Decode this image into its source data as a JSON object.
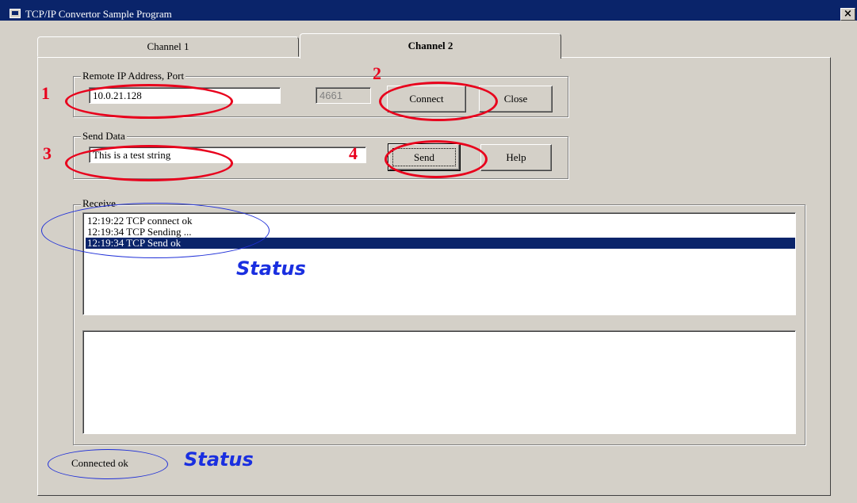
{
  "window": {
    "title": "TCP/IP Convertor Sample Program",
    "close_glyph": "×"
  },
  "tabs": [
    {
      "label": "Channel 1",
      "selected": false
    },
    {
      "label": "Channel 2",
      "selected": true
    }
  ],
  "remote": {
    "group_label": "Remote IP Address, Port",
    "ip": "10.0.21.128",
    "port": "4661",
    "connect_label": "Connect",
    "close_label": "Close"
  },
  "send": {
    "group_label": "Send Data",
    "text": "This is a test string",
    "send_label": "Send",
    "help_label": "Help"
  },
  "receive": {
    "group_label": "Receive",
    "log": [
      "12:19:22 TCP connect ok",
      "12:19:34 TCP Sending ...",
      "12:19:34 TCP Send ok"
    ],
    "selected_index": 2
  },
  "status_text": "Connected ok",
  "annotations": {
    "step1": "1",
    "step2": "2",
    "step3": "3",
    "step4": "4",
    "status_label": "Status"
  },
  "colors": {
    "accent_red": "#e8001c",
    "annotation_blue": "#1a2fe0",
    "selection": "#0a246a",
    "face": "#d4d0c8"
  }
}
